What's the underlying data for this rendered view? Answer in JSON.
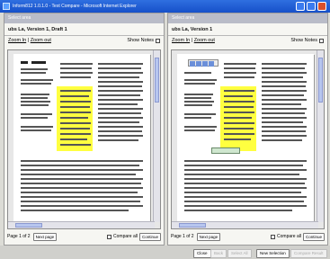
{
  "window": {
    "title": "Inform812 1.0.1.0 - Text Compare - Microsoft Internet Explorer"
  },
  "panes": [
    {
      "header": "Select area",
      "title": "ubs La, Version 1, Draft 1",
      "zoom_in": "Zoom In",
      "separator": "|",
      "zoom_out": "Zoom out",
      "show_notes": "Show Notes",
      "page_label": "Page 1 of 2",
      "next_page": "Next page",
      "compare_all": "Compare all",
      "continue": "Continue"
    },
    {
      "header": "Select area",
      "title": "ubs La, Version 1",
      "zoom_in": "Zoom In",
      "separator": "|",
      "zoom_out": "Zoom out",
      "show_notes": "Show Notes",
      "page_label": "Page 1 of 2",
      "next_page": "Next page",
      "compare_all": "Compare all",
      "continue": "Continue"
    }
  ],
  "footer": {
    "close": "Close",
    "back": "Back",
    "select_all": "Select All",
    "new_selection": "New Selection",
    "compare_result": "Compare Result"
  },
  "colors": {
    "titlebar": "#1650c9",
    "highlight": "#ffff00",
    "pane_header": "#b9bcc8"
  }
}
